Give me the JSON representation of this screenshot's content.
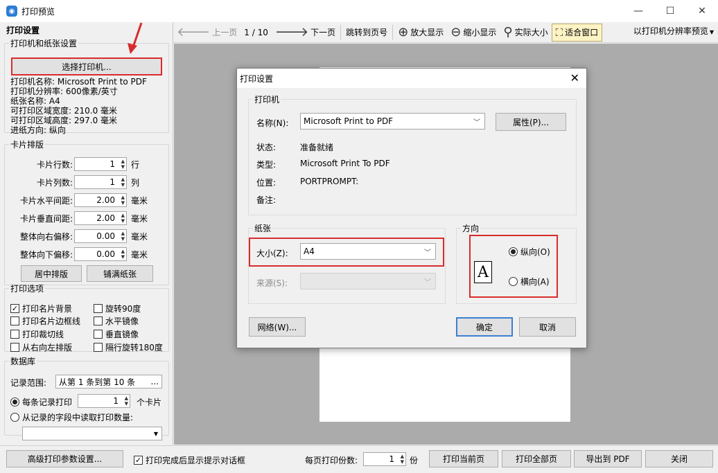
{
  "window": {
    "title": "打印预览",
    "minimize": "—",
    "maximize": "☐",
    "close": "✕"
  },
  "left": {
    "header": "打印设置",
    "printer_group": {
      "legend": "打印机和纸张设置",
      "select_button": "选择打印机...",
      "info": [
        "打印机名称: Microsoft Print to PDF",
        "打印机分辨率: 600像素/英寸",
        "纸张名称: A4",
        "可打印区域宽度: 210.0 毫米",
        "可打印区域高度: 297.0 毫米",
        "进纸方向: 纵向"
      ]
    },
    "layout_group": {
      "legend": "卡片排版",
      "rows": [
        {
          "label": "卡片行数:",
          "value": "1",
          "unit": "行"
        },
        {
          "label": "卡片列数:",
          "value": "1",
          "unit": "列"
        },
        {
          "label": "卡片水平间距:",
          "value": "2.00",
          "unit": "毫米"
        },
        {
          "label": "卡片垂直间距:",
          "value": "2.00",
          "unit": "毫米"
        },
        {
          "label": "整体向右偏移:",
          "value": "0.00",
          "unit": "毫米"
        },
        {
          "label": "整体向下偏移:",
          "value": "0.00",
          "unit": "毫米"
        }
      ],
      "center_button": "居中排版",
      "fill_button": "铺满纸张"
    },
    "options_group": {
      "legend": "打印选项",
      "items": [
        {
          "label": "打印名片背景",
          "checked": true
        },
        {
          "label": "旋转90度",
          "checked": false
        },
        {
          "label": "打印名片边框线",
          "checked": false
        },
        {
          "label": "水平镜像",
          "checked": false
        },
        {
          "label": "打印裁切线",
          "checked": false
        },
        {
          "label": "垂直镜像",
          "checked": false
        },
        {
          "label": "从右向左排版",
          "checked": false
        },
        {
          "label": "隔行旋转180度",
          "checked": false
        }
      ]
    },
    "db_group": {
      "legend": "数据库",
      "range_label": "记录范围:",
      "range_value": "从第 1 条到第 10 条",
      "range_more": "...",
      "per_record_label": "每条记录打印",
      "per_record_value": "1",
      "per_record_unit": "个卡片",
      "from_field_label": "从记录的字段中读取打印数量:",
      "field_value": ""
    }
  },
  "toolbar": {
    "prev": "上一页",
    "page_indicator": "1 / 10",
    "next": "下一页",
    "goto": "跳转到页号",
    "zoom_in": "放大显示",
    "zoom_out": "缩小显示",
    "actual": "实际大小",
    "fit": "适合窗口",
    "preview_mode": "以打印机分辨率预览"
  },
  "bottom": {
    "advanced": "高级打印参数设置...",
    "show_dialog_label": "打印完成后显示提示对话框",
    "show_dialog_checked": true,
    "copies_label": "每页打印份数:",
    "copies_value": "1",
    "copies_unit": "份",
    "print_current": "打印当前页",
    "print_all": "打印全部页",
    "export_pdf": "导出到 PDF",
    "close": "关闭"
  },
  "dialog": {
    "title": "打印设置",
    "printer_legend": "打印机",
    "name_label": "名称(N):",
    "name_value": "Microsoft Print to PDF",
    "properties_button": "属性(P)...",
    "status_label": "状态:",
    "status_value": "准备就绪",
    "type_label": "类型:",
    "type_value": "Microsoft Print To PDF",
    "where_label": "位置:",
    "where_value": "PORTPROMPT:",
    "comment_label": "备注:",
    "comment_value": "",
    "paper_legend": "纸张",
    "size_label": "大小(Z):",
    "size_value": "A4",
    "source_label": "来源(S):",
    "source_value": "",
    "orientation_legend": "方向",
    "portrait_label": "纵向(O)",
    "landscape_label": "横向(A)",
    "orientation_selected": "portrait",
    "orient_glyph": "A",
    "network_button": "网络(W)...",
    "ok_button": "确定",
    "cancel_button": "取消"
  },
  "colors": {
    "highlight_red": "#d92b2b",
    "preview_bg": "#ababab",
    "primary_border": "#3c7fd1"
  }
}
